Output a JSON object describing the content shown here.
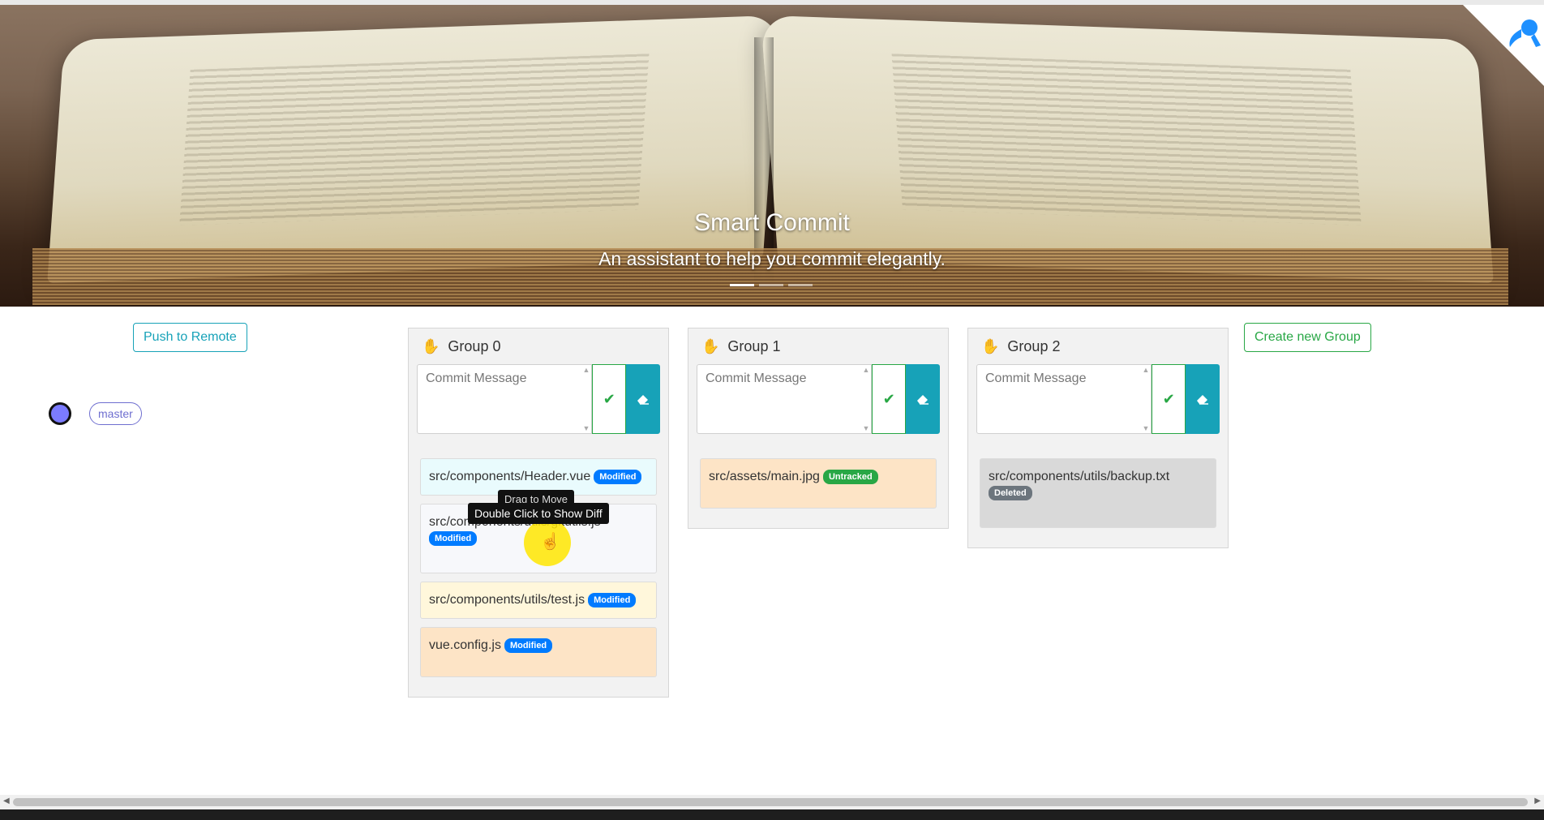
{
  "hero": {
    "title": "Smart Commit",
    "subtitle": "An assistant to help you commit elegantly.",
    "slide_count": 3,
    "active_slide": 1
  },
  "toolbar": {
    "push_label": "Push to Remote",
    "create_group_label": "Create new Group"
  },
  "branch": {
    "name": "master",
    "dot_color": "#7b7bff"
  },
  "groups": [
    {
      "title": "Group 0",
      "commit_placeholder": "Commit Message",
      "files": [
        {
          "path": "src/components/Header.vue",
          "status": "Modified"
        },
        {
          "path": "src/components/utils/gitutils.js",
          "status": "Modified"
        },
        {
          "path": "src/components/utils/test.js",
          "status": "Modified"
        },
        {
          "path": "vue.config.js",
          "status": "Modified"
        }
      ]
    },
    {
      "title": "Group 1",
      "commit_placeholder": "Commit Message",
      "files": [
        {
          "path": "src/assets/main.jpg",
          "status": "Untracked"
        }
      ]
    },
    {
      "title": "Group 2",
      "commit_placeholder": "Commit Message",
      "files": [
        {
          "path": "src/components/utils/backup.txt",
          "status": "Deleted"
        }
      ]
    }
  ],
  "tooltips": {
    "drag": "Drag to Move",
    "diff": "Double Click to Show Diff"
  },
  "colors": {
    "info": "#17a2b8",
    "success": "#28a745",
    "modified": "#007bff",
    "deleted": "#6c757d"
  },
  "icons": {
    "group_handle": "hand-icon",
    "commit": "check-icon",
    "clear": "eraser-icon",
    "corner": "github-octocat-icon"
  }
}
